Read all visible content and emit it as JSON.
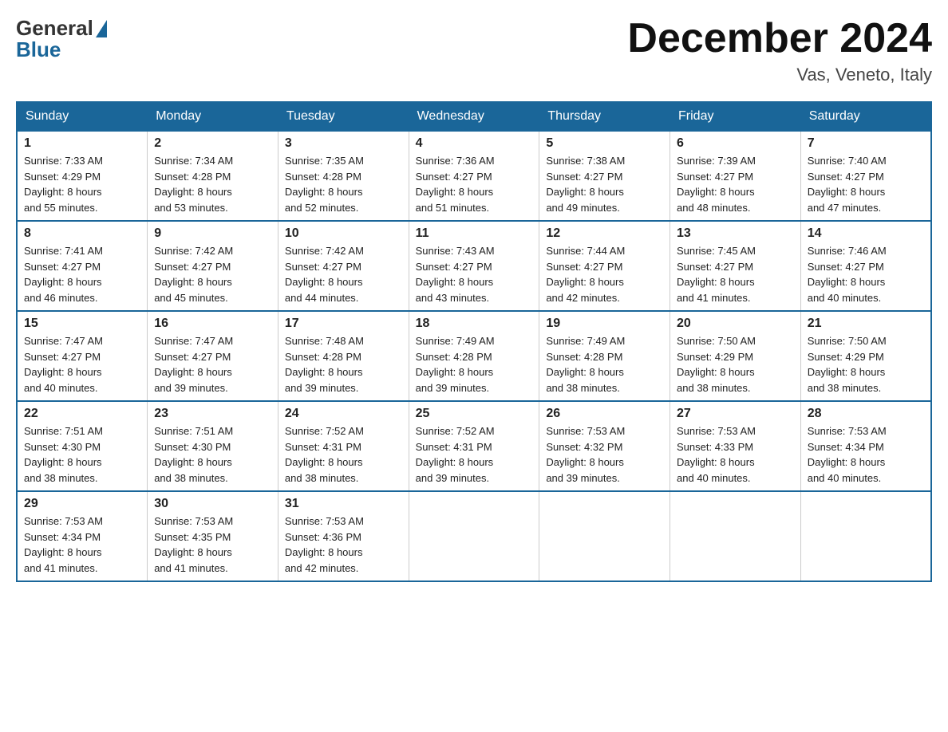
{
  "header": {
    "logo_general": "General",
    "logo_blue": "Blue",
    "month_title": "December 2024",
    "location": "Vas, Veneto, Italy"
  },
  "weekdays": [
    "Sunday",
    "Monday",
    "Tuesday",
    "Wednesday",
    "Thursday",
    "Friday",
    "Saturday"
  ],
  "weeks": [
    [
      {
        "day": "1",
        "sunrise": "7:33 AM",
        "sunset": "4:29 PM",
        "daylight": "8 hours and 55 minutes."
      },
      {
        "day": "2",
        "sunrise": "7:34 AM",
        "sunset": "4:28 PM",
        "daylight": "8 hours and 53 minutes."
      },
      {
        "day": "3",
        "sunrise": "7:35 AM",
        "sunset": "4:28 PM",
        "daylight": "8 hours and 52 minutes."
      },
      {
        "day": "4",
        "sunrise": "7:36 AM",
        "sunset": "4:27 PM",
        "daylight": "8 hours and 51 minutes."
      },
      {
        "day": "5",
        "sunrise": "7:38 AM",
        "sunset": "4:27 PM",
        "daylight": "8 hours and 49 minutes."
      },
      {
        "day": "6",
        "sunrise": "7:39 AM",
        "sunset": "4:27 PM",
        "daylight": "8 hours and 48 minutes."
      },
      {
        "day": "7",
        "sunrise": "7:40 AM",
        "sunset": "4:27 PM",
        "daylight": "8 hours and 47 minutes."
      }
    ],
    [
      {
        "day": "8",
        "sunrise": "7:41 AM",
        "sunset": "4:27 PM",
        "daylight": "8 hours and 46 minutes."
      },
      {
        "day": "9",
        "sunrise": "7:42 AM",
        "sunset": "4:27 PM",
        "daylight": "8 hours and 45 minutes."
      },
      {
        "day": "10",
        "sunrise": "7:42 AM",
        "sunset": "4:27 PM",
        "daylight": "8 hours and 44 minutes."
      },
      {
        "day": "11",
        "sunrise": "7:43 AM",
        "sunset": "4:27 PM",
        "daylight": "8 hours and 43 minutes."
      },
      {
        "day": "12",
        "sunrise": "7:44 AM",
        "sunset": "4:27 PM",
        "daylight": "8 hours and 42 minutes."
      },
      {
        "day": "13",
        "sunrise": "7:45 AM",
        "sunset": "4:27 PM",
        "daylight": "8 hours and 41 minutes."
      },
      {
        "day": "14",
        "sunrise": "7:46 AM",
        "sunset": "4:27 PM",
        "daylight": "8 hours and 40 minutes."
      }
    ],
    [
      {
        "day": "15",
        "sunrise": "7:47 AM",
        "sunset": "4:27 PM",
        "daylight": "8 hours and 40 minutes."
      },
      {
        "day": "16",
        "sunrise": "7:47 AM",
        "sunset": "4:27 PM",
        "daylight": "8 hours and 39 minutes."
      },
      {
        "day": "17",
        "sunrise": "7:48 AM",
        "sunset": "4:28 PM",
        "daylight": "8 hours and 39 minutes."
      },
      {
        "day": "18",
        "sunrise": "7:49 AM",
        "sunset": "4:28 PM",
        "daylight": "8 hours and 39 minutes."
      },
      {
        "day": "19",
        "sunrise": "7:49 AM",
        "sunset": "4:28 PM",
        "daylight": "8 hours and 38 minutes."
      },
      {
        "day": "20",
        "sunrise": "7:50 AM",
        "sunset": "4:29 PM",
        "daylight": "8 hours and 38 minutes."
      },
      {
        "day": "21",
        "sunrise": "7:50 AM",
        "sunset": "4:29 PM",
        "daylight": "8 hours and 38 minutes."
      }
    ],
    [
      {
        "day": "22",
        "sunrise": "7:51 AM",
        "sunset": "4:30 PM",
        "daylight": "8 hours and 38 minutes."
      },
      {
        "day": "23",
        "sunrise": "7:51 AM",
        "sunset": "4:30 PM",
        "daylight": "8 hours and 38 minutes."
      },
      {
        "day": "24",
        "sunrise": "7:52 AM",
        "sunset": "4:31 PM",
        "daylight": "8 hours and 38 minutes."
      },
      {
        "day": "25",
        "sunrise": "7:52 AM",
        "sunset": "4:31 PM",
        "daylight": "8 hours and 39 minutes."
      },
      {
        "day": "26",
        "sunrise": "7:53 AM",
        "sunset": "4:32 PM",
        "daylight": "8 hours and 39 minutes."
      },
      {
        "day": "27",
        "sunrise": "7:53 AM",
        "sunset": "4:33 PM",
        "daylight": "8 hours and 40 minutes."
      },
      {
        "day": "28",
        "sunrise": "7:53 AM",
        "sunset": "4:34 PM",
        "daylight": "8 hours and 40 minutes."
      }
    ],
    [
      {
        "day": "29",
        "sunrise": "7:53 AM",
        "sunset": "4:34 PM",
        "daylight": "8 hours and 41 minutes."
      },
      {
        "day": "30",
        "sunrise": "7:53 AM",
        "sunset": "4:35 PM",
        "daylight": "8 hours and 41 minutes."
      },
      {
        "day": "31",
        "sunrise": "7:53 AM",
        "sunset": "4:36 PM",
        "daylight": "8 hours and 42 minutes."
      },
      null,
      null,
      null,
      null
    ]
  ],
  "labels": {
    "sunrise": "Sunrise:",
    "sunset": "Sunset:",
    "daylight": "Daylight:"
  }
}
